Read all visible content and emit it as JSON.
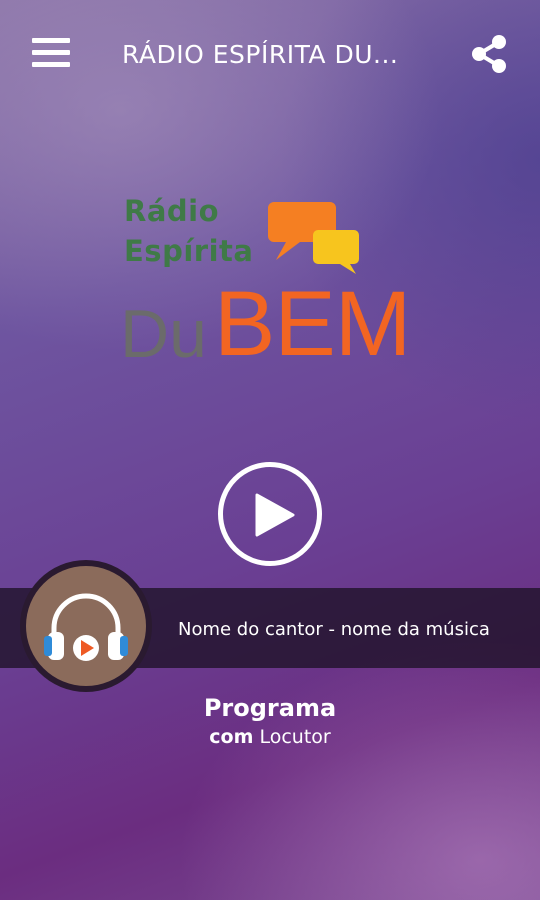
{
  "header": {
    "title": "RÁDIO ESPÍRITA DU...",
    "menu_icon": "hamburger-menu-icon",
    "share_icon": "share-icon"
  },
  "logo": {
    "line1": "Rádio",
    "line2": "Espírita",
    "du": "Du",
    "bem": "BEM"
  },
  "player": {
    "play_icon": "play-icon",
    "now_playing": "Nome do cantor - nome da música",
    "avatar_icon": "headphones-icon"
  },
  "program": {
    "name": "Programa",
    "with": "com",
    "host": "Locutor"
  },
  "colors": {
    "logo_green": "#3f7a47",
    "logo_gray": "#6b6b6b",
    "logo_orange": "#f26522",
    "bubble_yellow": "#f7c51e",
    "background_purple": "#6a3f93"
  }
}
